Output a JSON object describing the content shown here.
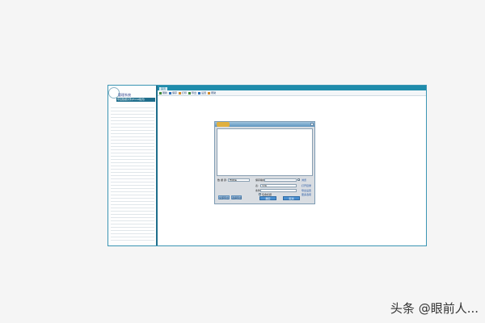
{
  "app": {
    "sidebar_title": "管理系统",
    "sidebar_selected": "导出数据文件(Excel格式)",
    "main_tab": "首页",
    "toolbar": [
      {
        "icon": "refresh-icon",
        "label": "刷新"
      },
      {
        "icon": "save-icon",
        "label": "保存"
      },
      {
        "icon": "print-icon",
        "label": "打印"
      },
      {
        "icon": "export-icon",
        "label": "导出"
      },
      {
        "icon": "settings-icon",
        "label": "设置"
      },
      {
        "icon": "help-icon",
        "label": "帮助"
      }
    ]
  },
  "dialog": {
    "type_label": "数 据 源:",
    "type_value": "数据库",
    "path_label": "保存路径:",
    "path_value": "",
    "row2_label": "表:",
    "row2_value": "全部",
    "row3_label": "条件:",
    "row3_value": "",
    "checkbox_label": "包含标题",
    "link_browse": "浏览",
    "link_open": "打开目录",
    "link_option": "导出设置",
    "link_more": "更多选项",
    "btn_left1": "全部导出",
    "btn_left2": "选择导出",
    "btn_ok": "确定",
    "btn_cancel": "取消"
  },
  "watermark": "头条 @眼前人..."
}
